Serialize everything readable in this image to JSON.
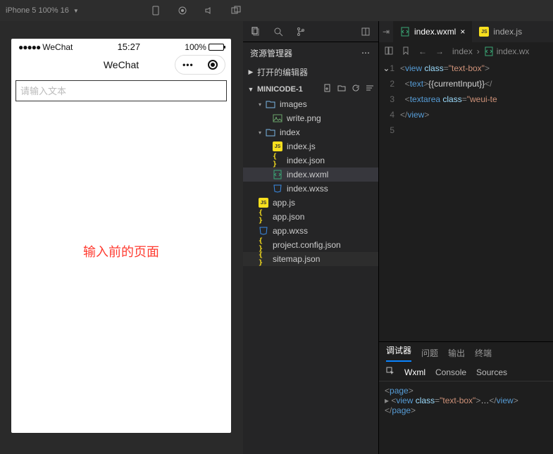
{
  "topbar": {
    "device_label": "iPhone 5 100% 16"
  },
  "simulator": {
    "status": {
      "carrier": "WeChat",
      "time": "15:27",
      "battery_pct": "100%"
    },
    "nav_title": "WeChat",
    "textarea_placeholder": "请输入文本",
    "annotation": "输入前的页面"
  },
  "explorer": {
    "title": "资源管理器",
    "sections": {
      "open_editors": "打开的编辑器",
      "workspace": "MINICODE-1"
    },
    "tree": [
      {
        "depth": 1,
        "kind": "folder",
        "label": "images",
        "expanded": true
      },
      {
        "depth": 2,
        "kind": "img",
        "label": "write.png"
      },
      {
        "depth": 1,
        "kind": "folder",
        "label": "index",
        "expanded": true
      },
      {
        "depth": 2,
        "kind": "js",
        "label": "index.js"
      },
      {
        "depth": 2,
        "kind": "json",
        "label": "index.json"
      },
      {
        "depth": 2,
        "kind": "wxml",
        "label": "index.wxml",
        "active": true
      },
      {
        "depth": 2,
        "kind": "wxss",
        "label": "index.wxss"
      },
      {
        "depth": 1,
        "kind": "js",
        "label": "app.js"
      },
      {
        "depth": 1,
        "kind": "json",
        "label": "app.json"
      },
      {
        "depth": 1,
        "kind": "wxss",
        "label": "app.wxss"
      },
      {
        "depth": 1,
        "kind": "json",
        "label": "project.config.json"
      },
      {
        "depth": 1,
        "kind": "json",
        "label": "sitemap.json",
        "dim": true
      }
    ]
  },
  "editor": {
    "tabs": [
      {
        "icon": "wxml",
        "label": "index.wxml",
        "active": true,
        "close": true
      },
      {
        "icon": "js",
        "label": "index.js",
        "active": false,
        "close": false
      }
    ],
    "crumbs": [
      {
        "icon": "",
        "label": "index"
      },
      {
        "icon": "wxml",
        "label": "index.wx"
      }
    ],
    "line_count": 5,
    "code_tokens": [
      [
        [
          "d",
          "<"
        ],
        [
          "a",
          "view"
        ],
        [
          "e",
          " "
        ],
        [
          "b",
          "class"
        ],
        [
          "d",
          "="
        ],
        [
          "c",
          "\"text-box\""
        ],
        [
          "d",
          ">"
        ]
      ],
      [
        [
          "e",
          "  "
        ],
        [
          "d",
          "<"
        ],
        [
          "a",
          "text"
        ],
        [
          "d",
          ">"
        ],
        [
          "e",
          "{{currentInput}}"
        ],
        [
          "d",
          "</"
        ]
      ],
      [
        [
          "e",
          "  "
        ],
        [
          "d",
          "<"
        ],
        [
          "a",
          "textarea"
        ],
        [
          "e",
          " "
        ],
        [
          "b",
          "class"
        ],
        [
          "d",
          "="
        ],
        [
          "c",
          "\"weui-te"
        ]
      ],
      [
        [
          "d",
          "</"
        ],
        [
          "a",
          "view"
        ],
        [
          "d",
          ">"
        ]
      ],
      []
    ]
  },
  "debugger": {
    "top_tabs": [
      "调试器",
      "问题",
      "输出",
      "终端"
    ],
    "top_active": 0,
    "sub_tabs": [
      "Wxml",
      "Console",
      "Sources"
    ],
    "sub_active": 0,
    "dom_lines": [
      {
        "indent": 0,
        "expand": "",
        "text": [
          [
            "ang",
            "<"
          ],
          [
            "tag",
            "page"
          ],
          [
            "ang",
            ">"
          ]
        ]
      },
      {
        "indent": 0,
        "expand": "▸",
        "text": [
          [
            "ang",
            "<"
          ],
          [
            "tag",
            "view"
          ],
          [
            "plain",
            " "
          ],
          [
            "attr",
            "class"
          ],
          [
            "ang",
            "="
          ],
          [
            "str",
            "\"text-box\""
          ],
          [
            "ang",
            ">"
          ],
          [
            "plain",
            "…"
          ],
          [
            "ang",
            "</"
          ],
          [
            "tag",
            "view"
          ],
          [
            "ang",
            ">"
          ]
        ]
      },
      {
        "indent": 0,
        "expand": "",
        "text": [
          [
            "ang",
            "</"
          ],
          [
            "tag",
            "page"
          ],
          [
            "ang",
            ">"
          ]
        ]
      }
    ]
  }
}
